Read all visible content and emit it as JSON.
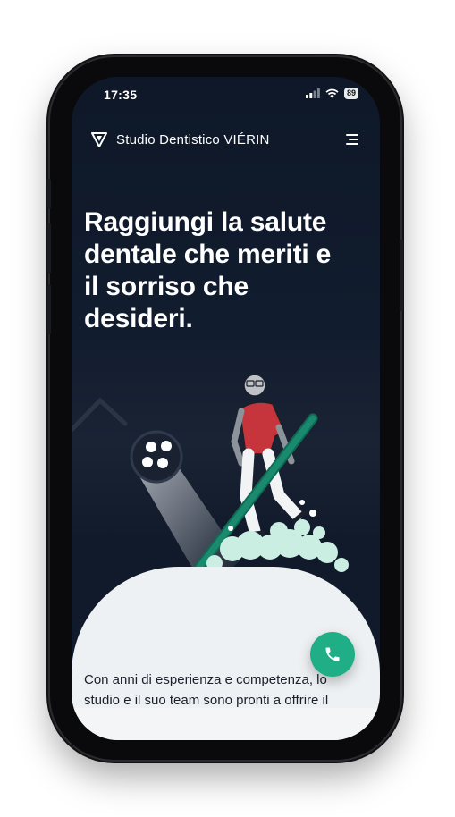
{
  "status_bar": {
    "time": "17:35",
    "battery": "89"
  },
  "nav": {
    "brand": "Studio Dentistico VIÉRIN"
  },
  "hero": {
    "title_lines": [
      "Raggiungi la salute",
      "dentale che meriti e",
      "il sorriso che",
      "desideri."
    ]
  },
  "intro": {
    "line1": "Con anni di esperienza e competenza, lo",
    "line2": "studio e il suo team sono pronti a offrire il"
  },
  "icons": {
    "logo": "v-logo-icon",
    "menu": "hamburger-menu-icon",
    "call": "phone-icon",
    "signal": "signal-icon",
    "wifi": "wifi-icon"
  },
  "colors": {
    "background": "#0e1828",
    "accent": "#1fae86",
    "text_light": "#ffffff"
  }
}
